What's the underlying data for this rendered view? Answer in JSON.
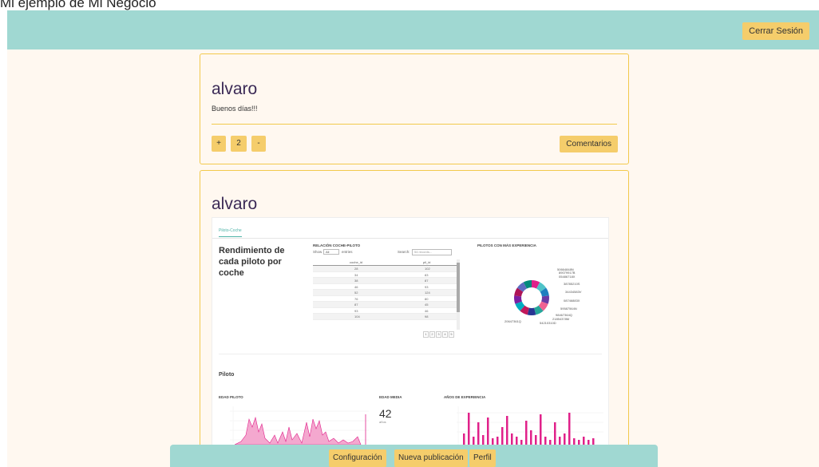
{
  "header": {
    "partial_title": "Mi ejemplo de Mi Negocio",
    "logout_label": "Cerrar Sesión"
  },
  "posts": [
    {
      "author": "alvaro",
      "text": "Buenos días!!!",
      "vote_up": "+",
      "vote_count": "2",
      "vote_down": "-",
      "comments_label": "Comentarios"
    },
    {
      "author": "alvaro",
      "image": {
        "tab": "Piloto-Coche",
        "title": "Rendimiento de cada piloto por coche",
        "table_title": "RELACIÓN COCHE-PILOTO",
        "show_label": "Show",
        "show_value": "All",
        "entries_label": "entries",
        "search_label": "Search:",
        "search_placeholder": "54 records...",
        "col_coche": "coche_id",
        "col_piloto": "pil_id",
        "rows": [
          [
            "28",
            "102"
          ],
          [
            "34",
            "83"
          ],
          [
            "38",
            "87"
          ],
          [
            "46",
            "93"
          ],
          [
            "52",
            "124"
          ],
          [
            "76",
            "80"
          ],
          [
            "87",
            "45"
          ],
          [
            "93",
            "46"
          ],
          [
            "104",
            "98"
          ]
        ],
        "pages": [
          "1",
          "2",
          "3",
          "4",
          "5"
        ],
        "donut_title": "PILOTOS CON MÁS EXPERIENCIA",
        "donut_labels": [
          "50664848N",
          "89079917B",
          "05486718X",
          "38785210S",
          "34434583V",
          "08746883X",
          "59587564N",
          "98467364Q",
          "21854378M",
          "54210310D",
          "20647361Q"
        ],
        "section_label": "Piloto",
        "edad_title": "EDAD PILOTO",
        "media_title": "EDAD MEDIA",
        "media_value": "42",
        "media_unit": "años",
        "exp_title": "AÑOS DE EXPERIENCIA"
      }
    }
  ],
  "bottom_nav": {
    "config_label": "Configuración",
    "new_post_label": "Nueva publicación",
    "profile_label": "Perfil"
  },
  "colors": {
    "header_bg": "#a0d8d2",
    "accent": "#f5cd6b",
    "border": "#f2c94c",
    "page_bg": "#fff8f0",
    "chart_pink": "#e0218a"
  }
}
